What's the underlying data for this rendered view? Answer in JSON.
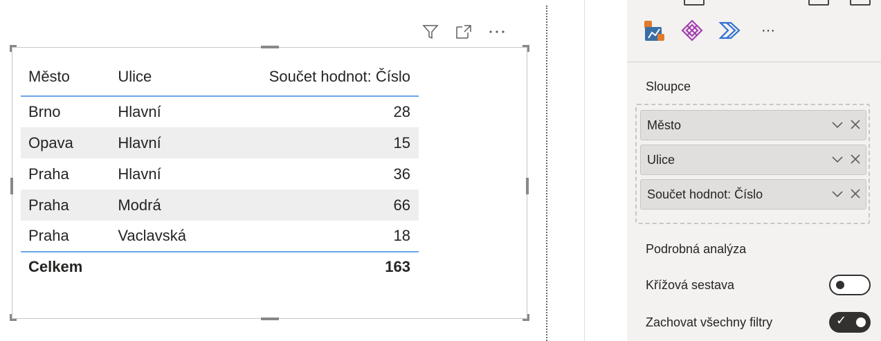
{
  "visual_header": {
    "icons": [
      "filter-icon",
      "focus-mode-icon",
      "more-options-icon"
    ]
  },
  "table": {
    "headers": [
      "Město",
      "Ulice",
      "Součet hodnot: Číslo"
    ],
    "rows": [
      {
        "mesto": "Brno",
        "ulice": "Hlavní",
        "cislo": "28"
      },
      {
        "mesto": "Opava",
        "ulice": "Hlavní",
        "cislo": "15"
      },
      {
        "mesto": "Praha",
        "ulice": "Hlavní",
        "cislo": "36"
      },
      {
        "mesto": "Praha",
        "ulice": "Modrá",
        "cislo": "66"
      },
      {
        "mesto": "Praha",
        "ulice": "Vaclavská",
        "cislo": "18"
      }
    ],
    "total": {
      "label": "Celkem",
      "value": "163"
    }
  },
  "pane": {
    "viz_icons": [
      "python-visual-icon",
      "power-apps-icon",
      "power-automate-icon",
      "more-visuals-icon"
    ],
    "more_glyph": "···",
    "columns_label": "Sloupce",
    "fields": [
      {
        "label": "Město"
      },
      {
        "label": "Ulice"
      },
      {
        "label": "Součet hodnot: Číslo"
      }
    ],
    "drillthrough_label": "Podrobná analýza",
    "cross_report": {
      "label": "Křížová sestava",
      "state": "off"
    },
    "keep_filters": {
      "label": "Zachovat všechny filtry",
      "state": "on"
    }
  },
  "colors": {
    "accent_line": "#6aa6e7",
    "band": "#eeeeee",
    "pane_bg": "#f3f2f1",
    "toggle_on": "#323130"
  }
}
